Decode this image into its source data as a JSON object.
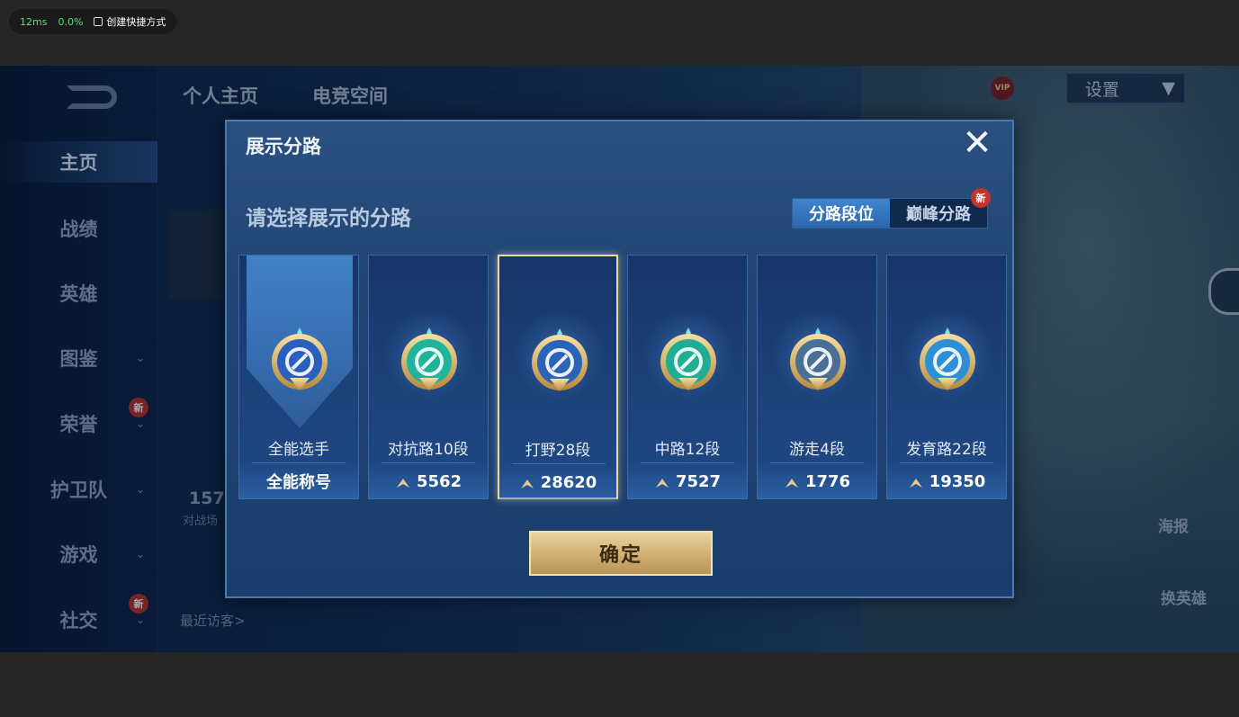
{
  "perf": {
    "latency": "12ms",
    "loss": "0.0%",
    "shortcut": "创建快捷方式"
  },
  "background": {
    "tabs": [
      "个人主页",
      "电竞空间"
    ],
    "settings": "设置",
    "vip": "VIP",
    "nav": [
      {
        "label": "主页",
        "arrow": false,
        "new": false
      },
      {
        "label": "战绩",
        "arrow": false,
        "new": false
      },
      {
        "label": "英雄",
        "arrow": false,
        "new": false
      },
      {
        "label": "图鉴",
        "arrow": true,
        "new": false
      },
      {
        "label": "荣誉",
        "arrow": true,
        "new": true
      },
      {
        "label": "护卫队",
        "arrow": true,
        "new": false
      },
      {
        "label": "游戏",
        "arrow": true,
        "new": false
      },
      {
        "label": "社交",
        "arrow": true,
        "new": true
      }
    ],
    "new_tag": "新",
    "stat_number": "157",
    "stat_caption": "对战场",
    "visitors_label": "最近访客>",
    "poster": "海报",
    "swap_hero": "换英雄"
  },
  "modal": {
    "title": "展示分路",
    "close_icon": "close-icon",
    "subtitle": "请选择展示的分路",
    "segments": [
      {
        "label": "分路段位",
        "active": true,
        "new": false
      },
      {
        "label": "巅峰分路",
        "active": false,
        "new": true
      }
    ],
    "new_tag": "新",
    "cards": [
      {
        "lane": "全能选手",
        "footer": "全能称号",
        "points": null,
        "selected": false,
        "badge": "all-rounder"
      },
      {
        "lane": "对抗路10段",
        "footer": null,
        "points": "5562",
        "selected": false,
        "badge": "clash-lane"
      },
      {
        "lane": "打野28段",
        "footer": null,
        "points": "28620",
        "selected": true,
        "badge": "jungle"
      },
      {
        "lane": "中路12段",
        "footer": null,
        "points": "7527",
        "selected": false,
        "badge": "mid-lane"
      },
      {
        "lane": "游走4段",
        "footer": null,
        "points": "1776",
        "selected": false,
        "badge": "roam"
      },
      {
        "lane": "发育路22段",
        "footer": null,
        "points": "19350",
        "selected": false,
        "badge": "farm-lane"
      }
    ],
    "confirm": "确定"
  }
}
